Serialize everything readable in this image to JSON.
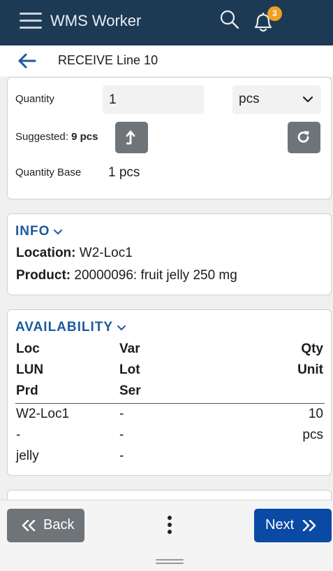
{
  "app": {
    "title": "WMS Worker",
    "notification_count": "3",
    "icons": [
      "menu-icon",
      "search-icon",
      "bell-icon"
    ]
  },
  "subheader": {
    "title": "RECEIVE Line 10",
    "icon": "arrow-left-icon"
  },
  "quantity": {
    "label": "Quantity",
    "value": "1",
    "unit": "pcs",
    "suggested_label": "Suggested:",
    "suggested_value": "9 pcs",
    "base_label": "Quantity Base",
    "base_value": "1 pcs"
  },
  "info": {
    "title": "INFO",
    "location_label": "Location:",
    "location_value": "W2-Loc1",
    "product_label": "Product:",
    "product_value": "20000096: fruit jelly 250 mg"
  },
  "availability": {
    "title": "AVAILABILITY",
    "headers": {
      "col1": [
        "Loc",
        "LUN",
        "Prd"
      ],
      "col2": [
        "Var",
        "Lot",
        "Ser"
      ],
      "col3": [
        "Qty",
        "Unit"
      ]
    },
    "row": {
      "col1": [
        "W2-Loc1",
        "-",
        "jelly"
      ],
      "col2": [
        "-",
        "-",
        "-"
      ],
      "col3": [
        "10",
        "pcs"
      ]
    }
  },
  "footer": {
    "back_label": "Back",
    "next_label": "Next"
  },
  "colors": {
    "topbar": "#1d3a55",
    "accent": "#1a5a9c",
    "next_button": "#0a4aa4",
    "gray_button": "#6e7478",
    "badge": "#f1a020"
  }
}
